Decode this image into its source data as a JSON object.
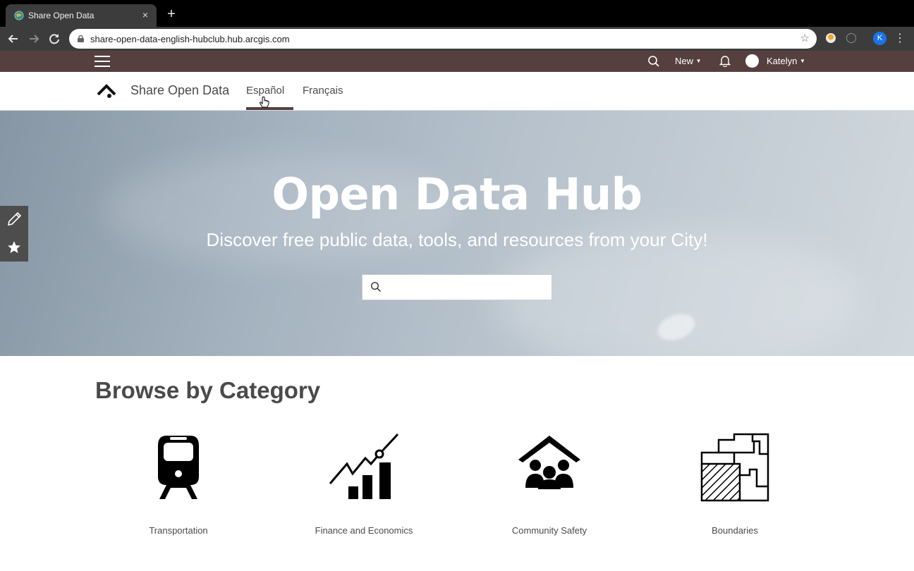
{
  "browser": {
    "tab_title": "Share Open Data",
    "tab_close": "×",
    "new_tab": "+",
    "url": "share-open-data-english-hubclub.hub.arcgis.com",
    "profile_initial": "K"
  },
  "adminbar": {
    "new_label": "New",
    "user_name": "Katelyn"
  },
  "header": {
    "site_title": "Share Open Data",
    "languages": [
      "Español",
      "Français"
    ],
    "active_language": "Español"
  },
  "hero": {
    "title": "Open Data Hub",
    "subtitle": "Discover free public data, tools, and resources from your City!",
    "search_value": "",
    "search_placeholder": ""
  },
  "browse": {
    "title": "Browse by Category",
    "categories": [
      {
        "label": "Transportation",
        "icon": "train-icon"
      },
      {
        "label": "Finance and Economics",
        "icon": "finance-chart-icon"
      },
      {
        "label": "Community Safety",
        "icon": "community-house-icon"
      },
      {
        "label": "Boundaries",
        "icon": "boundaries-map-icon"
      }
    ]
  },
  "colors": {
    "admin_bar": "#56403f",
    "chrome_dark": "#3c3c3c",
    "text": "#4a4a4a"
  }
}
